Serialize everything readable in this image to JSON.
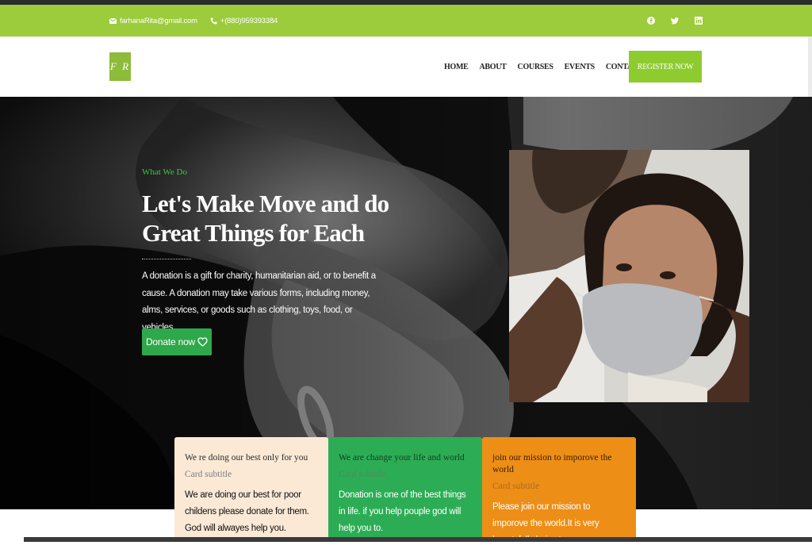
{
  "topbar": {
    "email": "farhanaRita@gmail.com",
    "phone": "+(880)959393384",
    "social_icons": [
      "facebook-icon",
      "twitter-icon",
      "linkedin-icon"
    ],
    "color": "#9ccb3b"
  },
  "navbar": {
    "logo_text": "F R",
    "links": [
      "HOME",
      "ABOUT",
      "COURSES",
      "EVENTS",
      "CONTACT"
    ],
    "register_label": "REGISTER NOW",
    "accent_color": "#8dcb2f"
  },
  "hero": {
    "eyebrow": "What We Do",
    "headline_line1": "Let's Make Move and do",
    "headline_line2": "Great Things for Each",
    "description": "A donation is a gift for charity, humanitarian aid, or to benefit a cause. A donation may take various forms, including money, alms, services, or goods such as clothing, toys, food, or vehicles.",
    "donate_label": "Donate now",
    "donate_icon": "heart-icon",
    "button_color": "#2ea84a"
  },
  "cards": [
    {
      "title": "We re doing our best only for you",
      "subtitle": "Card subtitle",
      "text": "We are doing our best for poor childens please donate for them. God will alwayes help you.",
      "color": "#fbe9d6"
    },
    {
      "title": "We are change your life and world",
      "subtitle": "Card subtitle",
      "text": "Donation is one of the best things in life. if you help pouple god will help you to.",
      "color": "#2cad55"
    },
    {
      "title": "join our mission to imporove the world",
      "subtitle": "Card subtitle",
      "text": "Please join our mission to imporove the world.It is very beautyfull choice to",
      "color": "#ed8e16"
    }
  ]
}
